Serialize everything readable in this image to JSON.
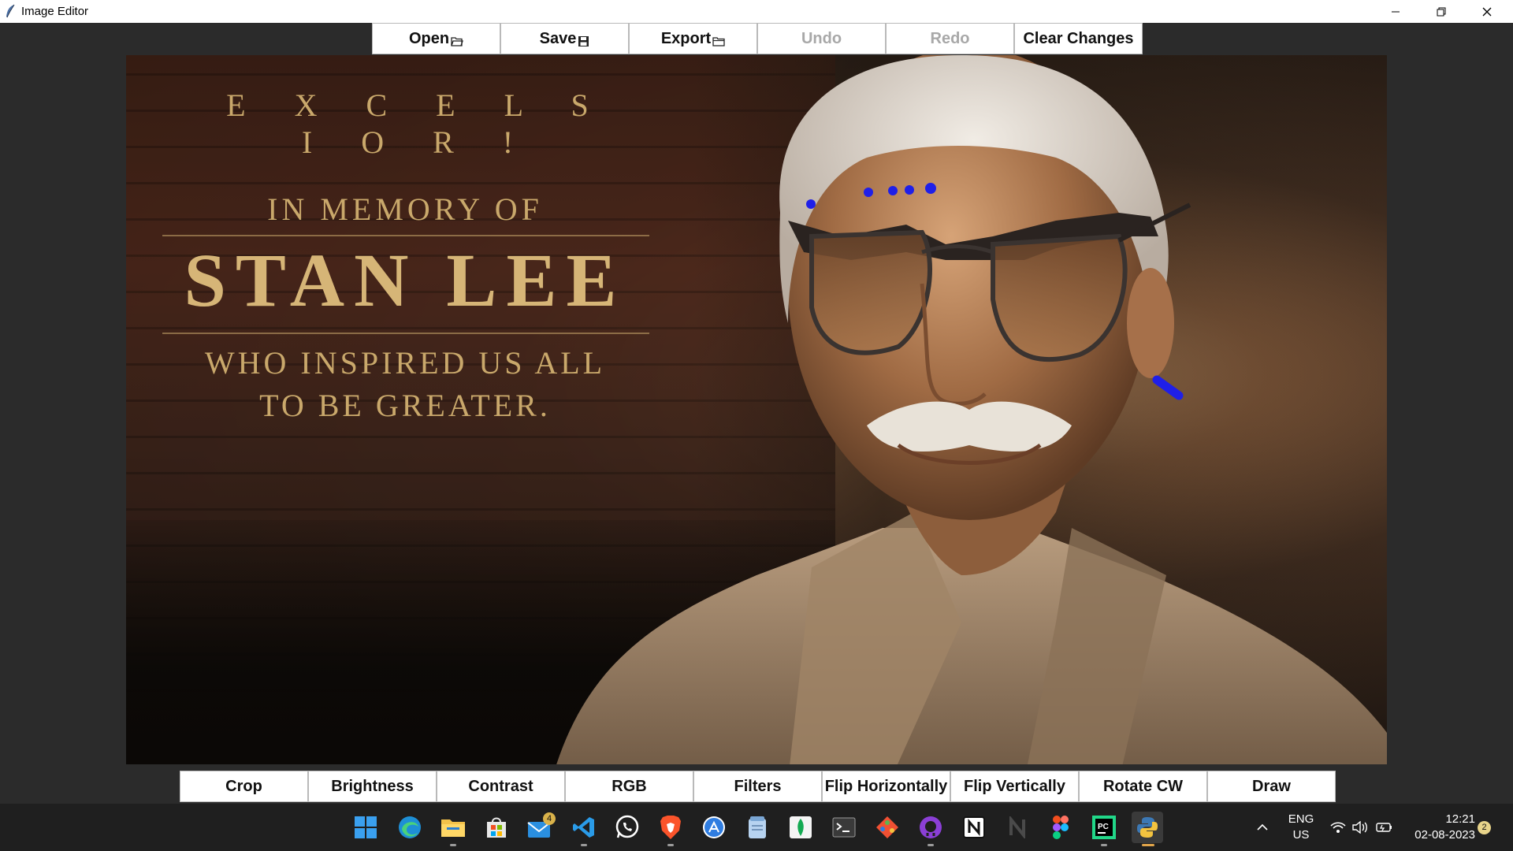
{
  "window": {
    "title": "Image Editor",
    "controls": [
      "minimize",
      "restore",
      "close"
    ]
  },
  "top_toolbar": {
    "buttons": [
      {
        "label": "Open",
        "icon": "folder-open-icon",
        "enabled": true
      },
      {
        "label": "Save",
        "icon": "floppy-icon",
        "enabled": true
      },
      {
        "label": "Export",
        "icon": "folder-icon",
        "enabled": true
      },
      {
        "label": "Undo",
        "enabled": false
      },
      {
        "label": "Redo",
        "enabled": false
      },
      {
        "label": "Clear Changes",
        "enabled": true
      }
    ]
  },
  "canvas": {
    "image_text": {
      "line1": "E X C E L S I O R !",
      "line2": "IN MEMORY OF",
      "line3": "STAN LEE",
      "line4": "WHO INSPIRED US ALL",
      "line5": "TO BE GREATER."
    },
    "draw_color": "#1f1fe8"
  },
  "bottom_toolbar": {
    "buttons": [
      {
        "label": "Crop"
      },
      {
        "label": "Brightness"
      },
      {
        "label": "Contrast"
      },
      {
        "label": "RGB"
      },
      {
        "label": "Filters"
      },
      {
        "label": "Flip Horizontally"
      },
      {
        "label": "Flip Vertically"
      },
      {
        "label": "Rotate CW"
      },
      {
        "label": "Draw"
      }
    ]
  },
  "taskbar": {
    "apps": [
      "windows-start-icon",
      "edge-icon",
      "file-explorer-icon",
      "store-icon",
      "mail-icon",
      "vscode-icon",
      "whatsapp-icon",
      "brave-icon",
      "app-store-icon",
      "notepad-icon",
      "mongodb-icon",
      "terminal-icon",
      "git-icon",
      "github-desktop-icon",
      "notion-icon",
      "notion-alt-icon",
      "figma-icon",
      "pycharm-icon",
      "python-icon"
    ],
    "mail_badge": "4",
    "language_line1": "ENG",
    "language_line2": "US",
    "time": "12:21",
    "date": "02-08-2023",
    "notification_count": "2"
  }
}
